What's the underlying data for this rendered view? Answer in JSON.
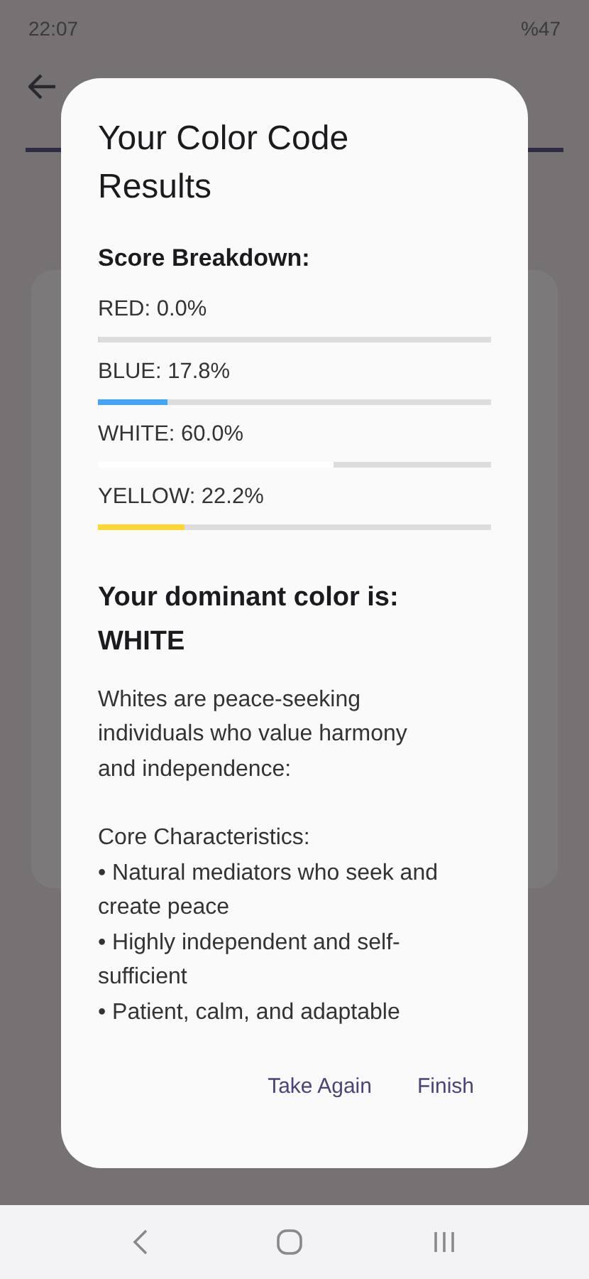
{
  "status_bar": {
    "time": "22:07",
    "battery": "%47"
  },
  "dialog": {
    "title": "Your Color Code Results",
    "breakdown_heading": "Score Breakdown:",
    "scores": [
      {
        "label": "RED: 0.0%",
        "level": 0.0
      },
      {
        "label": "BLUE: 17.8%",
        "level": 0.178,
        "color": "#42a5f5"
      },
      {
        "label": "WHITE: 60.0%",
        "level": 0.6,
        "color": "#ffffff"
      },
      {
        "label": "YELLOW: 22.2%",
        "level": 0.222,
        "color": "#fdd835"
      }
    ],
    "dominant_heading": "Your dominant color is:",
    "dominant_color": "WHITE",
    "description": [
      {
        "kind": "paragraph",
        "text": "Whites are peace-seeking individuals who value harmony and independence:"
      },
      {
        "kind": "heading",
        "text": "Core Characteristics:"
      },
      {
        "kind": "bullet",
        "text": "• Natural mediators who seek and create peace"
      },
      {
        "kind": "bullet",
        "text": "• Highly independent and self-sufficient"
      },
      {
        "kind": "bullet",
        "text": "• Patient, calm, and adaptable"
      }
    ],
    "actions": [
      "Take Again",
      "Finish"
    ]
  }
}
